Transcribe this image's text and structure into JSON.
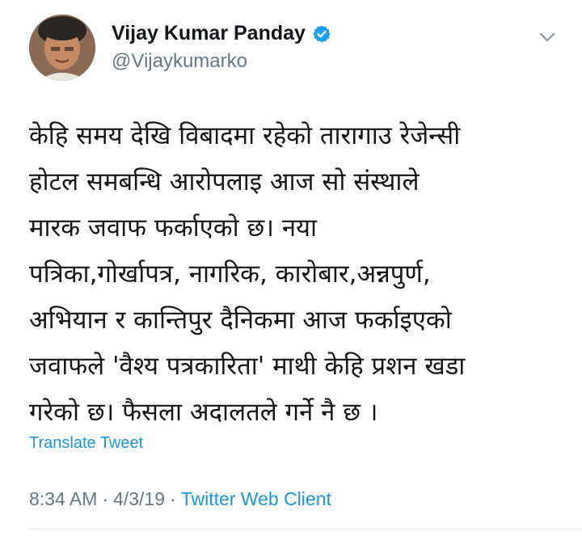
{
  "author": {
    "display_name": "Vijay Kumar Panday",
    "handle": "@Vijaykumarko",
    "verified": true
  },
  "icons": {
    "verified": "verified-badge-icon",
    "menu": "chevron-down-icon"
  },
  "tweet": {
    "lines": [
      "केहि समय देखि विबादमा रहेको तारागाउ रेजेन्सी",
      "होटल समबन्धि आरोपलाइ आज सो संस्थाले",
      "मारक जवाफ फर्काएको छ। नया",
      "पत्रिका,गोर्खापत्र, नागरिक, कारोबार,अन्नपुर्ण,",
      "अभियान र कान्तिपुर दैनिकमा आज फर्काइएको",
      "जवाफले 'वैश्य पत्रकारिता' माथी केहि प्रशन खडा",
      "गरेको छ। फैसला अदालतले गर्ने नै छ ।"
    ]
  },
  "translate_label": "Translate Tweet",
  "meta": {
    "time": "8:34 AM",
    "sep1": "·",
    "date": "4/3/19",
    "sep2": "·",
    "client": "Twitter Web Client"
  },
  "colors": {
    "link": "#1b95e0",
    "muted": "#657786",
    "text": "#14171a",
    "verified": "#1da1f2"
  }
}
